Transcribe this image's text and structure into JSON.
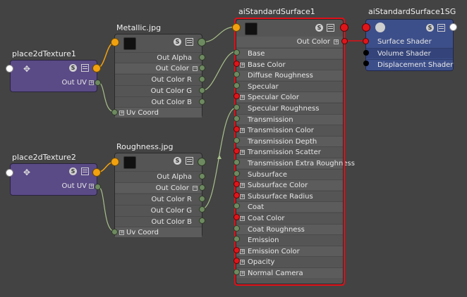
{
  "nodes": {
    "place1": {
      "title": "place2dTexture1",
      "out_label": "Out UV"
    },
    "place2": {
      "title": "place2dTexture2",
      "out_label": "Out UV"
    },
    "metallic": {
      "title": "Metallic.jpg",
      "outputs": [
        "Out Alpha",
        "Out Color",
        "Out Color R",
        "Out Color G",
        "Out Color B"
      ],
      "input": "Uv Coord"
    },
    "roughness": {
      "title": "Roughness.jpg",
      "outputs": [
        "Out Alpha",
        "Out Color",
        "Out Color R",
        "Out Color G",
        "Out Color B"
      ],
      "input": "Uv Coord"
    },
    "ai": {
      "title": "aiStandardSurface1",
      "out_label": "Out Color",
      "inputs": [
        "Base",
        "Base Color",
        "Diffuse Roughness",
        "Specular",
        "Specular Color",
        "Specular Roughness",
        "Transmission",
        "Transmission Color",
        "Transmission Depth",
        "Transmission Scatter",
        "Transmission Extra Roughness",
        "Subsurface",
        "Subsurface Color",
        "Subsurface Radius",
        "Coat",
        "Coat Color",
        "Coat Roughness",
        "Emission",
        "Emission Color",
        "Opacity",
        "Normal Camera"
      ]
    },
    "sg": {
      "title": "aiStandardSurface1SG",
      "inputs": [
        "Surface Shader",
        "Volume Shader",
        "Displacement Shader"
      ]
    }
  },
  "icons": {
    "s_button": "S"
  },
  "colors": {
    "selection": "#e01018",
    "wire": "#a8c08a",
    "wire_orange": "#f2a20f",
    "texture_node": "#5a4a86",
    "shading_group": "#3d4f8a"
  }
}
